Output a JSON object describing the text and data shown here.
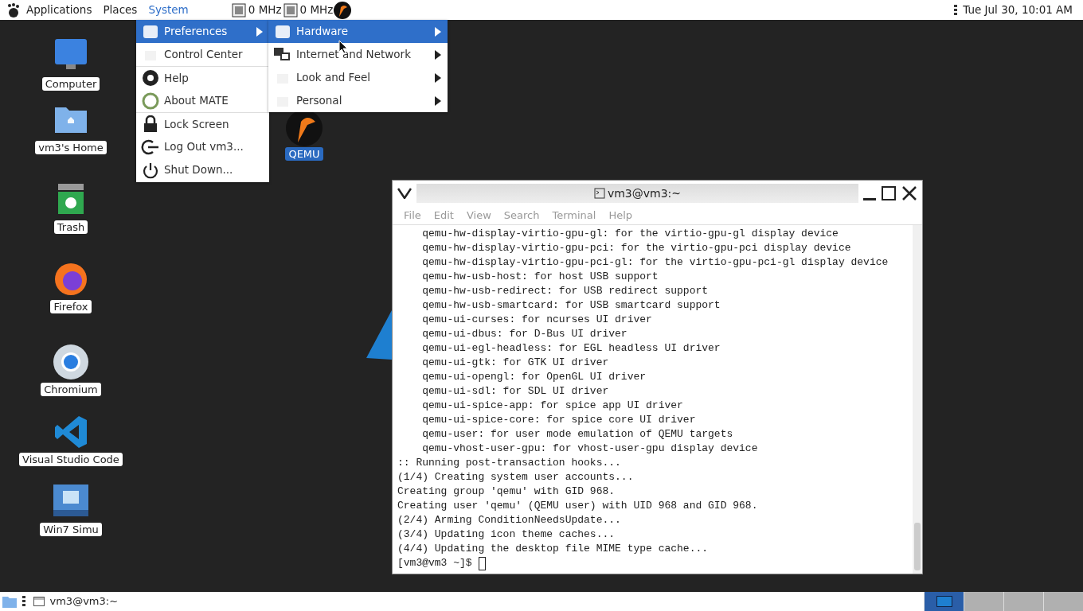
{
  "top_panel": {
    "menus": [
      {
        "label": "Applications",
        "selected": false
      },
      {
        "label": "Places",
        "selected": false
      },
      {
        "label": "System",
        "selected": true
      }
    ],
    "cpu_monitors": [
      {
        "reading": "0 MHz"
      },
      {
        "reading": "0 MHz"
      }
    ],
    "clock": "Tue Jul 30, 10:01 AM"
  },
  "system_menu": {
    "sections": [
      [
        {
          "label": "Preferences",
          "selected": true,
          "submenu": true
        },
        {
          "label": "Control Center",
          "selected": false,
          "submenu": false
        }
      ],
      [
        {
          "label": "Help",
          "selected": false,
          "submenu": false
        },
        {
          "label": "About MATE",
          "selected": false,
          "submenu": false
        }
      ],
      [
        {
          "label": "Lock Screen",
          "selected": false,
          "submenu": false
        },
        {
          "label": "Log Out vm3...",
          "selected": false,
          "submenu": false
        },
        {
          "label": "Shut Down...",
          "selected": false,
          "submenu": false
        }
      ]
    ]
  },
  "preferences_menu": {
    "items": [
      {
        "label": "Hardware",
        "selected": true
      },
      {
        "label": "Internet and Network",
        "selected": false
      },
      {
        "label": "Look and Feel",
        "selected": false
      },
      {
        "label": "Personal",
        "selected": false
      }
    ]
  },
  "desktop_icons": [
    {
      "label": "Computer",
      "kind": "computer",
      "selected": false
    },
    {
      "label": "vm3's Home",
      "kind": "folder",
      "selected": false
    },
    {
      "label": "Trash",
      "kind": "trash",
      "selected": false
    },
    {
      "label": "Firefox",
      "kind": "firefox",
      "selected": false
    },
    {
      "label": "Chromium",
      "kind": "chromium",
      "selected": false
    },
    {
      "label": "Visual Studio Code",
      "kind": "vscode",
      "selected": false
    },
    {
      "label": "Win7 Simu",
      "kind": "win7",
      "selected": false
    }
  ],
  "qemu_icon": {
    "label": "QEMU",
    "selected": true
  },
  "terminal": {
    "title": "vm3@vm3:~",
    "menu": [
      "File",
      "Edit",
      "View",
      "Search",
      "Terminal",
      "Help"
    ],
    "lines": [
      "    qemu-hw-display-virtio-gpu-gl: for the virtio-gpu-gl display device",
      "    qemu-hw-display-virtio-gpu-pci: for the virtio-gpu-pci display device",
      "    qemu-hw-display-virtio-gpu-pci-gl: for the virtio-gpu-pci-gl display device",
      "    qemu-hw-usb-host: for host USB support",
      "    qemu-hw-usb-redirect: for USB redirect support",
      "    qemu-hw-usb-smartcard: for USB smartcard support",
      "    qemu-ui-curses: for ncurses UI driver",
      "    qemu-ui-dbus: for D-Bus UI driver",
      "    qemu-ui-egl-headless: for EGL headless UI driver",
      "    qemu-ui-gtk: for GTK UI driver",
      "    qemu-ui-opengl: for OpenGL UI driver",
      "    qemu-ui-sdl: for SDL UI driver",
      "    qemu-ui-spice-app: for spice app UI driver",
      "    qemu-ui-spice-core: for spice core UI driver",
      "    qemu-user: for user mode emulation of QEMU targets",
      "    qemu-vhost-user-gpu: for vhost-user-gpu display device",
      ":: Running post-transaction hooks...",
      "(1/4) Creating system user accounts...",
      "Creating group 'qemu' with GID 968.",
      "Creating user 'qemu' (QEMU user) with UID 968 and GID 968.",
      "(2/4) Arming ConditionNeedsUpdate...",
      "(3/4) Updating icon theme caches...",
      "(4/4) Updating the desktop file MIME type cache..."
    ],
    "prompt": "[vm3@vm3 ~]$"
  },
  "taskbar": {
    "tasks": [
      {
        "label": "vm3@vm3:~"
      }
    ],
    "workspaces": [
      {
        "selected": true
      },
      {
        "selected": false
      },
      {
        "selected": false
      },
      {
        "selected": false
      }
    ]
  }
}
